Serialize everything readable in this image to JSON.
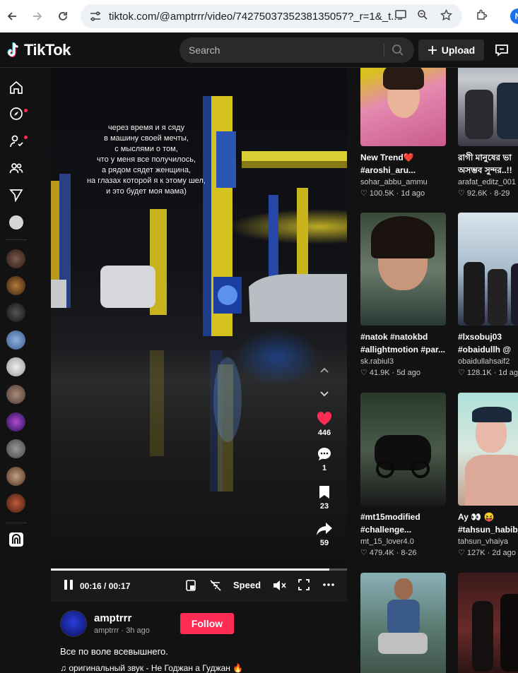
{
  "browser": {
    "url": "tiktok.com/@amptrrr/video/7427503735238135057?_r=1&_t...",
    "profile_initial": "N"
  },
  "header": {
    "logo_text": "TikTok",
    "search_placeholder": "Search",
    "upload_label": "Upload"
  },
  "video": {
    "overlay_text": "через время и я сяду\nв машину своей мечты,\nс мыслями о том,\nчто у меня все получилось,\nа рядом сядет женщина,\nна глазах которой я к этому шел,\nи это будет моя мама)",
    "time": "00:16 / 00:17",
    "progress_fraction": 0.94,
    "speed_label": "Speed",
    "likes": "446",
    "comments": "1",
    "saves": "23",
    "shares": "59"
  },
  "author": {
    "name": "amptrrr",
    "sub": "amptrrr · 3h ago",
    "follow_label": "Follow",
    "description": "Все по воле всевышнего.",
    "music": "♫  оригинальный звук - Не Годжан а Гуджан 🔥"
  },
  "grid": [
    {
      "title": "New Trend❤️",
      "title2": "#aroshi_aru...",
      "user": "sohar_abbu_ammu",
      "views": "100.5K",
      "age": "1d ago"
    },
    {
      "title": "রাগী মানুষের ভা",
      "title2": "অসম্ভব সুন্দর..!!",
      "user": "arafat_editz_001",
      "views": "92.6K",
      "age": "8-29"
    },
    {
      "title": "#natok #natokbd",
      "title2": "#allightmotion #par...",
      "user": "sk.rabiul3",
      "views": "41.9K",
      "age": "5d ago"
    },
    {
      "title": "#lxsobuj03",
      "title2": "#obaidullh @",
      "user": "obaidullahsaif2",
      "views": "128.1K",
      "age": "1d ag"
    },
    {
      "title": "#mt15modified",
      "title2": "#challenge...",
      "user": "mt_15_lover4.0",
      "views": "479.4K",
      "age": "8-26"
    },
    {
      "title": "Ay 👀 😝",
      "title2": "#tahsun_habib_",
      "user": "tahsun_vhaiya",
      "views": "127K",
      "age": "2d ago"
    },
    {
      "title": "",
      "title2": "",
      "user": "",
      "views": "",
      "age": ""
    },
    {
      "title": "",
      "title2": "",
      "user": "",
      "views": "",
      "age": ""
    }
  ],
  "colors": {
    "accent": "#fe2c55",
    "background": "#121212",
    "panel": "#2a2a2a"
  }
}
